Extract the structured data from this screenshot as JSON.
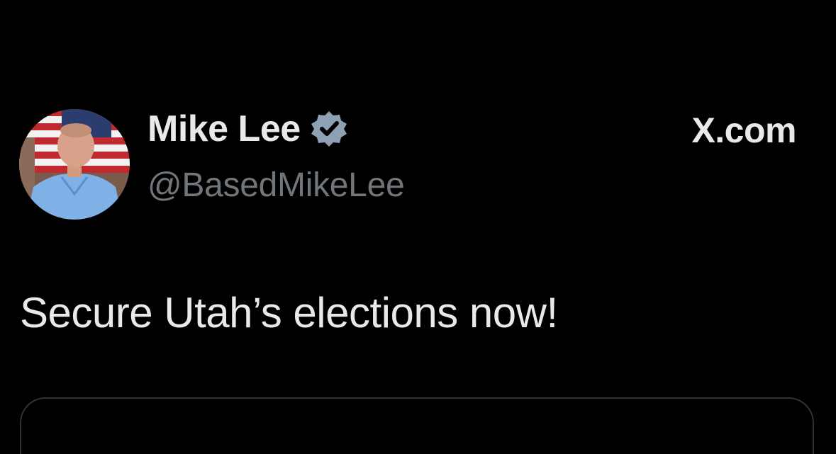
{
  "author": {
    "display_name": "Mike Lee",
    "handle": "@BasedMikeLee",
    "verified_icon": "verified-badge-icon",
    "avatar_description_icon": "profile-photo"
  },
  "header": {
    "site_label": "X.com"
  },
  "tweet": {
    "text": "Secure Utah’s elections now!"
  },
  "colors": {
    "background": "#000000",
    "primary_text": "#e7e9ea",
    "secondary_text": "#71767b",
    "verified_badge": "#8ea0b3",
    "card_border": "#2f3336"
  }
}
